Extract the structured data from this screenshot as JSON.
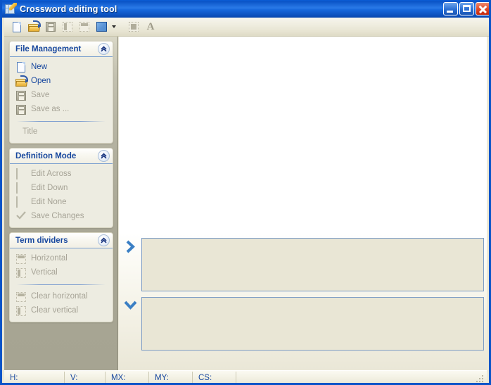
{
  "window": {
    "title": "Crossword editing tool",
    "icon": "crossword-pencil-icon",
    "minimize_label": "Minimize",
    "maximize_label": "Maximize",
    "close_label": "Close"
  },
  "toolbar": {
    "buttons": [
      {
        "name": "new-document",
        "icon": "new-document-icon",
        "enabled": true
      },
      {
        "name": "open-file",
        "icon": "open-folder-icon",
        "enabled": true
      },
      {
        "name": "save-file",
        "icon": "floppy-disk-icon",
        "enabled": false
      },
      {
        "name": "vertical-divider",
        "icon": "vertical-divider-icon",
        "enabled": false
      },
      {
        "name": "horizontal-divider",
        "icon": "horizontal-divider-icon",
        "enabled": false
      },
      {
        "name": "color-swatch",
        "icon": "color-swatch-icon",
        "enabled": true,
        "color": "#5a93d6"
      },
      {
        "name": "color-dropdown",
        "icon": "chevron-down-icon",
        "enabled": true
      },
      {
        "name": "fill-square",
        "icon": "filled-square-icon",
        "enabled": false
      },
      {
        "name": "text-style",
        "icon": "letter-a-icon",
        "enabled": false
      }
    ]
  },
  "sidebar": {
    "panels": [
      {
        "title": "File Management",
        "collapse_icon": "double-chevron-up-icon",
        "items": [
          {
            "label": "New",
            "icon": "new-document-icon",
            "enabled": true
          },
          {
            "label": "Open",
            "icon": "open-folder-icon",
            "enabled": true
          },
          {
            "label": "Save",
            "icon": "floppy-disk-icon",
            "enabled": false
          },
          {
            "label": "Save as ...",
            "icon": "floppy-disk-icon",
            "enabled": false
          }
        ],
        "separator": true,
        "footer_label": "Title"
      },
      {
        "title": "Definition Mode",
        "collapse_icon": "double-chevron-up-icon",
        "items": [
          {
            "label": "Edit Across",
            "icon": "checkbox-icon",
            "enabled": false
          },
          {
            "label": "Edit Down",
            "icon": "checkbox-icon",
            "enabled": false
          },
          {
            "label": "Edit None",
            "icon": "checkbox-icon",
            "enabled": false
          },
          {
            "label": "Save Changes",
            "icon": "checkmark-icon",
            "enabled": false
          }
        ]
      },
      {
        "title": "Term  dividers",
        "collapse_icon": "double-chevron-up-icon",
        "items": [
          {
            "label": "Horizontal",
            "icon": "horizontal-divider-icon",
            "enabled": false
          },
          {
            "label": "Vertical",
            "icon": "vertical-divider-icon",
            "enabled": false
          }
        ],
        "separator": true,
        "items2": [
          {
            "label": "Clear horizontal",
            "icon": "horizontal-divider-icon",
            "enabled": false
          },
          {
            "label": "Clear vertical",
            "icon": "vertical-divider-icon",
            "enabled": false
          }
        ]
      }
    ]
  },
  "main": {
    "grid_area_empty": true,
    "clues": [
      {
        "direction_icon": "chevron-right-icon",
        "direction": "across",
        "value": "",
        "placeholder": ""
      },
      {
        "direction_icon": "chevron-down-icon",
        "direction": "down",
        "value": "",
        "placeholder": ""
      }
    ]
  },
  "statusbar": {
    "cells": [
      {
        "label": "H:",
        "value": ""
      },
      {
        "label": "V:",
        "value": ""
      },
      {
        "label": "MX:",
        "value": ""
      },
      {
        "label": "MY:",
        "value": ""
      },
      {
        "label": "CS:",
        "value": ""
      }
    ],
    "grip_icon": "resize-grip-icon"
  },
  "colors": {
    "titlebar_blue": "#0a54c8",
    "accent_blue": "#17479e",
    "panel_bg": "#edece1",
    "sidebar_bg": "#a9a795",
    "clue_box_bg": "#e9e6d5",
    "clue_box_border": "#7d9cc4"
  }
}
